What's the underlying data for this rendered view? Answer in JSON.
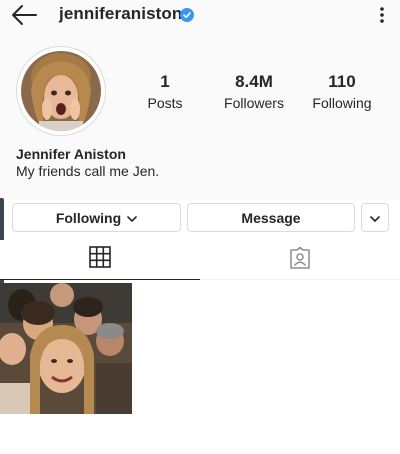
{
  "header": {
    "username": "jenniferaniston",
    "back_icon": "arrow-left-icon",
    "verified_icon": "verified-badge-icon",
    "more_icon": "vertical-dots-icon"
  },
  "profile": {
    "avatar_icon": "profile-photo",
    "stats": [
      {
        "value": "1",
        "label": "Posts"
      },
      {
        "value": "8.4M",
        "label": "Followers"
      },
      {
        "value": "110",
        "label": "Following"
      }
    ],
    "name": "Jennifer Aniston",
    "bio": "My friends call me Jen."
  },
  "actions": {
    "following_label": "Following",
    "message_label": "Message",
    "chevron_icon": "chevron-down-icon"
  },
  "tabs": [
    {
      "icon": "grid-icon",
      "active": true
    },
    {
      "icon": "tagged-icon",
      "active": false
    }
  ],
  "posts": [
    {
      "icon": "post-photo"
    }
  ],
  "colors": {
    "verified": "#3897f0",
    "text": "#262626",
    "border": "#dbdbdb",
    "header_bg": "#fafafa"
  }
}
